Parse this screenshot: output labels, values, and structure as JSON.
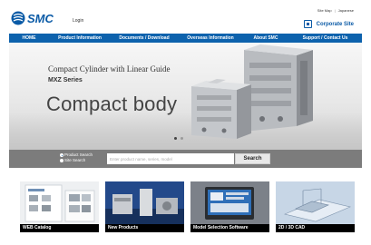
{
  "header": {
    "logo_text": "SMC",
    "login": "Login",
    "site_map": "Site Map",
    "language": "Japanese",
    "corporate_site": "Corporate Site"
  },
  "nav": {
    "items": [
      {
        "label": "HOME"
      },
      {
        "label": "Product Information"
      },
      {
        "label": "Documents / Download"
      },
      {
        "label": "Overseas Information"
      },
      {
        "label": "About SMC"
      },
      {
        "label": "Support / Contact Us"
      }
    ]
  },
  "hero": {
    "subtitle": "Compact Cylinder with Linear Guide",
    "series": "MXZ Series",
    "title": "Compact body"
  },
  "search": {
    "option_product": "Product Search",
    "option_site": "Site Search",
    "selected": "Product Search",
    "placeholder": "Enter product name, series, model",
    "button": "Search"
  },
  "tiles": [
    {
      "label": "WEB Catalog"
    },
    {
      "label": "New Products"
    },
    {
      "label": "Model Selection Software"
    },
    {
      "label": "2D / 3D CAD"
    }
  ],
  "colors": {
    "brand_blue": "#0d62ad",
    "search_bar": "#7c7c7c"
  }
}
